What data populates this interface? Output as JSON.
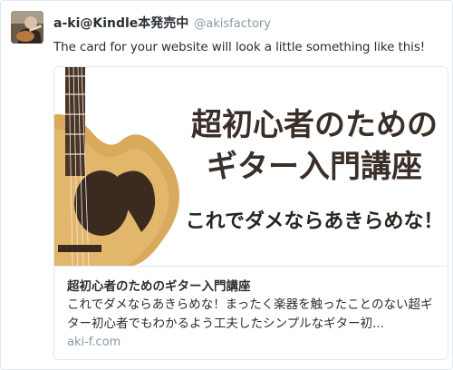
{
  "tweet": {
    "display_name": "a-ki@Kindle本発売中",
    "screen_name": "@akisfactory",
    "text": "The card for your website will look a little something like this!"
  },
  "card": {
    "image": {
      "headline_line1": "超初心者のための",
      "headline_line2": "ギター入門講座",
      "headline_line3": "これでダメならあきらめな！"
    },
    "title": "超初心者のためのギター入門講座",
    "description": "これでダメならあきらめな！まったく楽器を触ったことのない超ギター初心者でもわかるよう工夫したシンプルなギター初...",
    "domain": "aki-f.com"
  },
  "colors": {
    "name": "#292f33",
    "muted": "#8899a6",
    "border": "#e1e8ed",
    "headline": "#3a2f28",
    "guitar_body": "#d4a55a"
  }
}
